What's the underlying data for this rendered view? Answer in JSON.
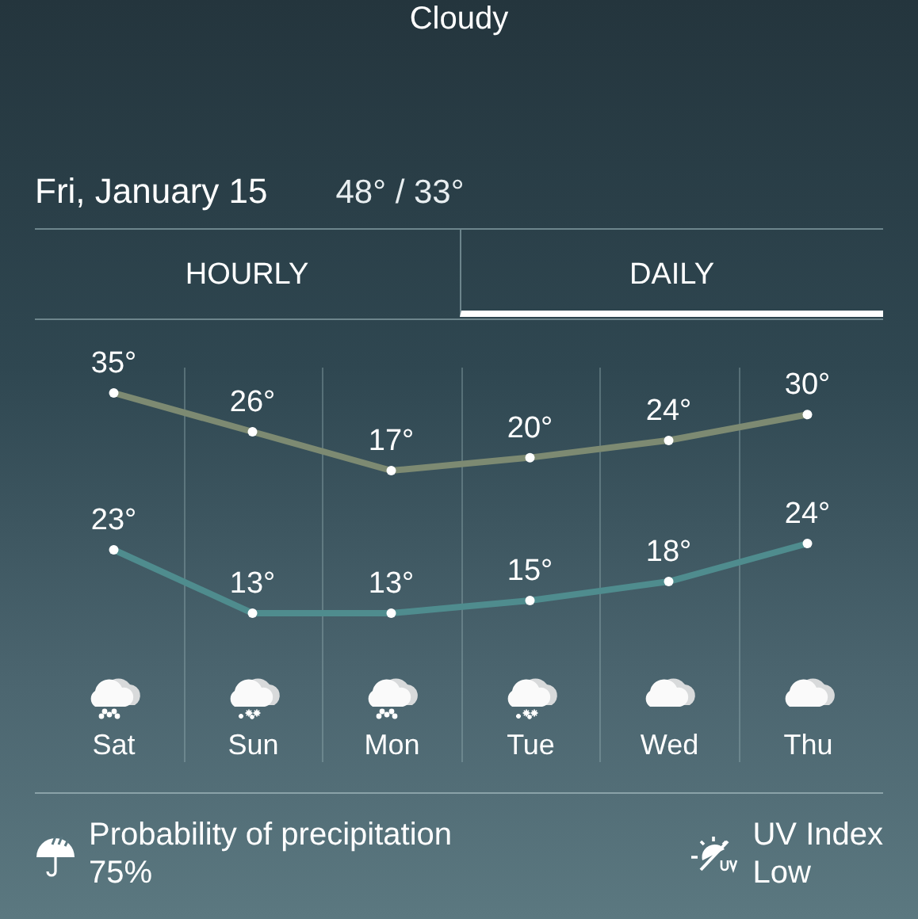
{
  "condition": "Cloudy",
  "date": "Fri, January 15",
  "high_low": "48° / 33°",
  "tabs": [
    {
      "label": "HOURLY",
      "selected": false
    },
    {
      "label": "DAILY",
      "selected": true
    }
  ],
  "days": [
    {
      "day": "Sat",
      "kind": "snow_dots",
      "high": "35°",
      "low": "23°"
    },
    {
      "day": "Sun",
      "kind": "snow_flakes",
      "high": "26°",
      "low": "13°"
    },
    {
      "day": "Mon",
      "kind": "snow_dots",
      "high": "17°",
      "low": "13°"
    },
    {
      "day": "Tue",
      "kind": "snow_flakes",
      "high": "20°",
      "low": "15°"
    },
    {
      "day": "Wed",
      "kind": "cloud",
      "high": "24°",
      "low": "18°"
    },
    {
      "day": "Thu",
      "kind": "cloud",
      "high": "30°",
      "low": "24°"
    }
  ],
  "precipitation": {
    "label": "Probability of precipitation",
    "value": "75%"
  },
  "uv": {
    "label": "UV Index",
    "value": "Low"
  }
}
